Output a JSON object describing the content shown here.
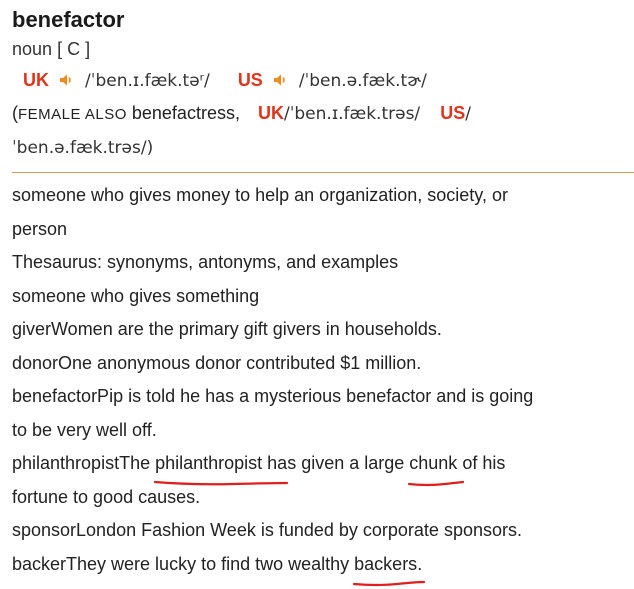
{
  "entry": {
    "headword": "benefactor",
    "pos": "noun",
    "grammar": "[ C ]",
    "uk_label": "UK",
    "uk_ipa": "/ˈben.ɪ.fæk.təʳ/",
    "us_label": "US",
    "us_ipa": "/ˈben.ə.fæk.tɚ/",
    "female_open": "(",
    "female_caps": "FEMALE ALSO",
    "female_word": "benefactress,",
    "female_uk_label": "UK",
    "female_uk_ipa": "/ˈben.ɪ.fæk.trəs/",
    "female_us_label": "US",
    "female_us_ipa_a": "/",
    "female_us_ipa_b": "ˈben.ə.fæk.trəs/)"
  },
  "definitions": {
    "line1": "someone who gives money to help an organization, society, or",
    "line2": "person",
    "thesaurus": "Thesaurus: synonyms, antonyms, and examples",
    "gives_something": "someone who gives something",
    "giver": "giverWomen are the primary gift givers in households.",
    "donor": "donorOne anonymous donor contributed $1 million.",
    "benefactor_a": "benefactorPip is told he has a mysterious benefactor and is going",
    "benefactor_b": "to be very well off.",
    "phil_a": "philanthropistThe ",
    "phil_word": "philanthropist",
    "phil_b": " has given a large ",
    "phil_chunk": "chunk",
    "phil_c": " of his",
    "phil_d": "fortune to good causes.",
    "sponsor": "sponsorLondon Fashion Week is funded by corporate sponsors.",
    "backer_a": "backerThey were lucky to find two wealthy ",
    "backer_word": "backers",
    "backer_b": "."
  },
  "colors": {
    "region": "#e2331b",
    "divider": "#c8a15a",
    "annotation": "#e21d1d",
    "speaker": "#f08a1c"
  }
}
